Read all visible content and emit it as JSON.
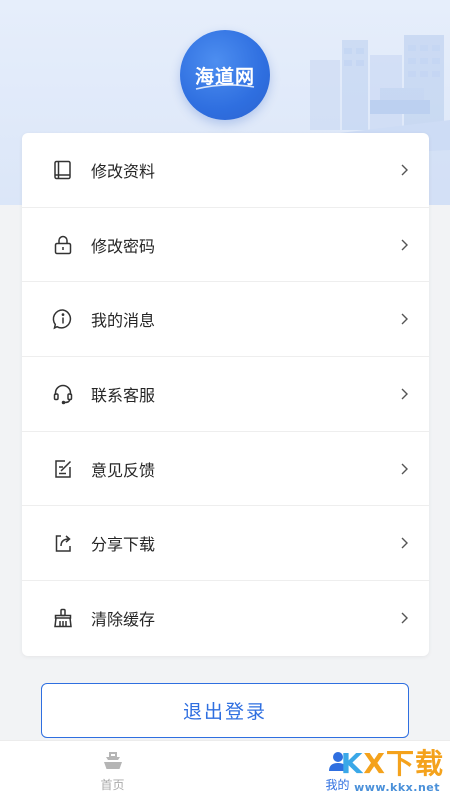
{
  "logo": {
    "text": "海道网"
  },
  "menu": [
    {
      "label": "修改资料",
      "icon": "book-icon"
    },
    {
      "label": "修改密码",
      "icon": "lock-icon"
    },
    {
      "label": "我的消息",
      "icon": "info-icon"
    },
    {
      "label": "联系客服",
      "icon": "headset-icon"
    },
    {
      "label": "意见反馈",
      "icon": "edit-note-icon"
    },
    {
      "label": "分享下载",
      "icon": "share-icon"
    },
    {
      "label": "清除缓存",
      "icon": "broom-icon"
    }
  ],
  "logout": {
    "label": "退出登录"
  },
  "tabs": [
    {
      "label": "首页",
      "icon": "ship-icon",
      "active": false
    },
    {
      "label": "我的",
      "icon": "user-icon",
      "active": true
    }
  ],
  "watermark": {
    "brand_k": "K",
    "brand_rest": "X下载",
    "url": "www.kkx.net"
  },
  "colors": {
    "accent": "#2f6fe0",
    "background": "#f2f3f5",
    "hero": "#e3ecfa",
    "watermark_orange": "#f4a21c"
  }
}
